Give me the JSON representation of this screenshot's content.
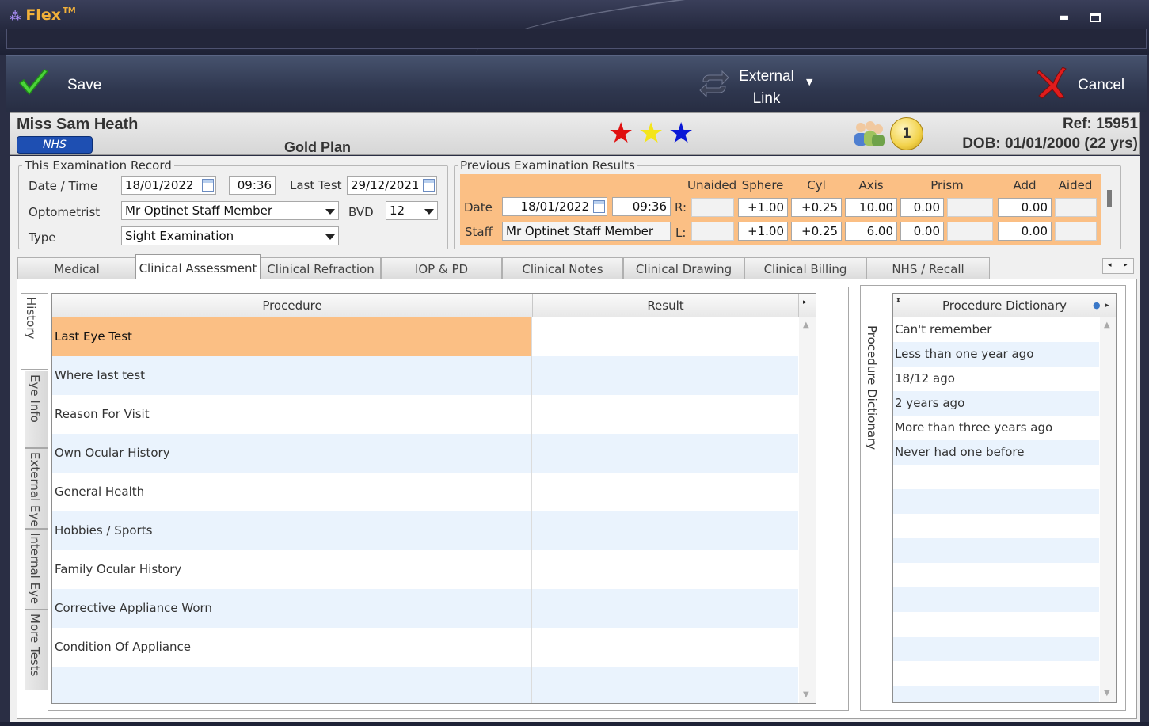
{
  "window": {
    "app_name": "Flex",
    "trademark": "TM"
  },
  "toolbar": {
    "save_label": "Save",
    "external_link_line1": "External",
    "external_link_line2": "Link",
    "cancel_label": "Cancel"
  },
  "patient": {
    "name": "Miss Sam Heath",
    "badge": "NHS",
    "plan": "Gold Plan",
    "stars": [
      "red",
      "yellow",
      "blue"
    ],
    "coin_count": "1",
    "ref": "Ref: 15951",
    "dob": "DOB: 01/01/2000 (22 yrs)"
  },
  "this_exam": {
    "legend": "This Examination Record",
    "date_time_label": "Date / Time",
    "date": "18/01/2022",
    "time": "09:36",
    "last_test_label": "Last Test",
    "last_test": "29/12/2021",
    "optometrist_label": "Optometrist",
    "optometrist": "Mr Optinet Staff Member",
    "bvd_label": "BVD",
    "bvd": "12",
    "type_label": "Type",
    "type": "Sight Examination"
  },
  "prev_exam": {
    "legend": "Previous Examination Results",
    "headers": [
      "Unaided",
      "Sphere",
      "Cyl",
      "Axis",
      "Prism",
      "Add",
      "Aided"
    ],
    "date_label": "Date",
    "date": "18/01/2022",
    "time": "09:36",
    "staff_label": "Staff",
    "staff": "Mr Optinet Staff Member",
    "right_label": "R:",
    "left_label": "L:",
    "right": {
      "unaided": "",
      "sphere": "+1.00",
      "cyl": "+0.25",
      "axis": "10.00",
      "prism1": "0.00",
      "prism2": "",
      "add": "0.00",
      "aided": ""
    },
    "left": {
      "unaided": "",
      "sphere": "+1.00",
      "cyl": "+0.25",
      "axis": "6.00",
      "prism1": "0.00",
      "prism2": "",
      "add": "0.00",
      "aided": ""
    }
  },
  "tabs": [
    "Medical Assessment",
    "Clinical Assessment",
    "Clinical Refraction",
    "IOP & PD",
    "Clinical Notes",
    "Clinical Drawing",
    "Clinical Billing",
    "NHS / Recall"
  ],
  "active_tab": "Clinical Assessment",
  "vertical_tabs": [
    "History",
    "Eye Info",
    "External Eye",
    "Internal Eye",
    "More Tests"
  ],
  "grid": {
    "headers": [
      "Procedure",
      "Result"
    ],
    "rows": [
      {
        "procedure": "Last Eye Test",
        "result": ""
      },
      {
        "procedure": "Where last test",
        "result": ""
      },
      {
        "procedure": "Reason For Visit",
        "result": ""
      },
      {
        "procedure": "Own Ocular History",
        "result": ""
      },
      {
        "procedure": "General Health",
        "result": ""
      },
      {
        "procedure": "Hobbies / Sports",
        "result": ""
      },
      {
        "procedure": "Family Ocular History",
        "result": ""
      },
      {
        "procedure": "Corrective Appliance Worn",
        "result": ""
      },
      {
        "procedure": "Condition Of Appliance",
        "result": ""
      }
    ]
  },
  "dictionary": {
    "side_tab": "Procedure Dictionary",
    "header": "Procedure Dictionary",
    "items": [
      "Can't remember",
      "Less than one year ago",
      "18/12 ago",
      "2 years ago",
      "More than three years ago",
      "Never had one before"
    ]
  },
  "colors": {
    "selection": "#fbbf84",
    "alt_row": "#eaf3fd",
    "nhs_badge": "#1e4fb2"
  }
}
